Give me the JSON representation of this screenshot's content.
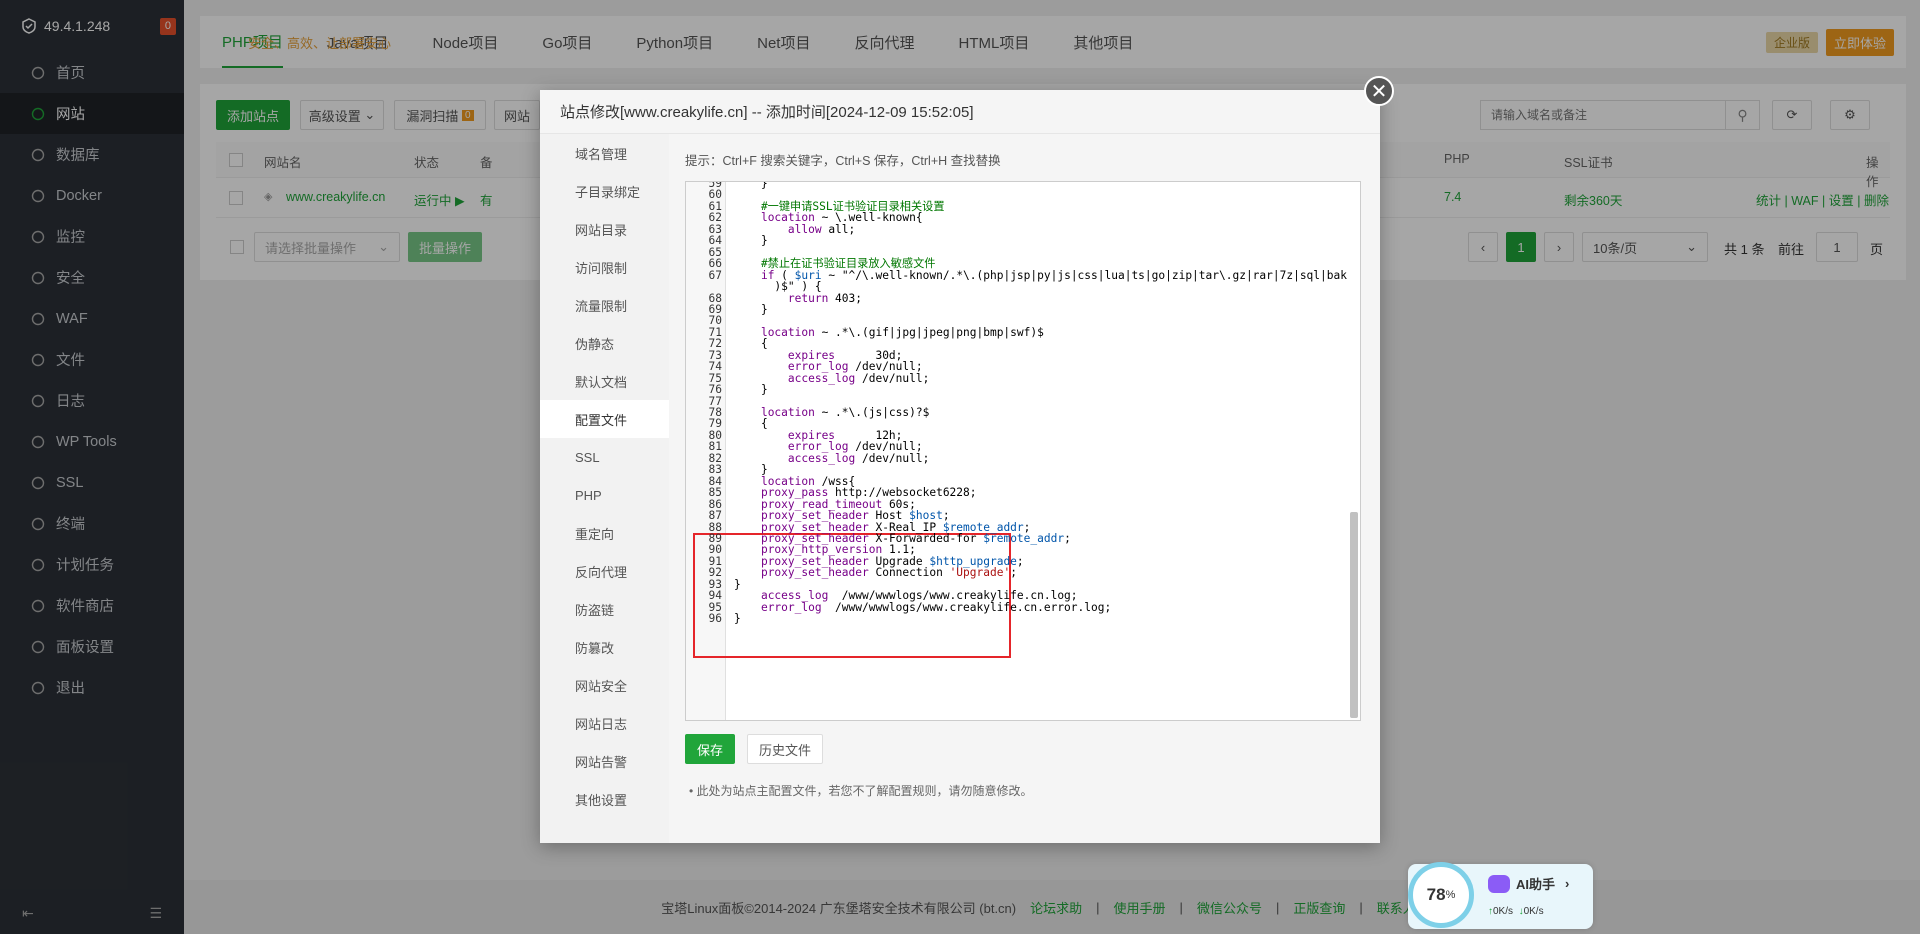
{
  "sidebar": {
    "ip": "49.4.1.248",
    "badge": "0",
    "items": [
      {
        "label": "首页",
        "icon": "home-icon"
      },
      {
        "label": "网站",
        "icon": "globe-icon"
      },
      {
        "label": "数据库",
        "icon": "database-icon"
      },
      {
        "label": "Docker",
        "icon": "docker-icon"
      },
      {
        "label": "监控",
        "icon": "monitor-icon"
      },
      {
        "label": "安全",
        "icon": "shield-icon"
      },
      {
        "label": "WAF",
        "icon": "waf-icon"
      },
      {
        "label": "文件",
        "icon": "folder-icon"
      },
      {
        "label": "日志",
        "icon": "log-icon"
      },
      {
        "label": "WP Tools",
        "icon": "wordpress-icon"
      },
      {
        "label": "SSL",
        "icon": "ssl-icon"
      },
      {
        "label": "终端",
        "icon": "terminal-icon"
      },
      {
        "label": "计划任务",
        "icon": "calendar-icon"
      },
      {
        "label": "软件商店",
        "icon": "store-icon"
      },
      {
        "label": "面板设置",
        "icon": "gear-icon"
      },
      {
        "label": "退出",
        "icon": "logout-icon"
      }
    ]
  },
  "topnav": {
    "tabs": [
      "PHP项目",
      "Java项目",
      "Node项目",
      "Go项目",
      "Python项目",
      "Net项目",
      "反向代理",
      "HTML项目",
      "其他项目"
    ],
    "promo_tag": "企业版",
    "promo_text": "安全、高效、让部署安心",
    "promo_button": "立即体验"
  },
  "toolbar": {
    "add_site": "添加站点",
    "advanced": "高级设置",
    "scan": "漏洞扫描",
    "scan_badge": "0",
    "site_short": "网站",
    "search_placeholder": "请输入域名或备注"
  },
  "table": {
    "headers": [
      "网站名",
      "状态",
      "备",
      "PHP",
      "SSL证书",
      "操作"
    ],
    "row": {
      "name": "www.creakylife.cn",
      "status": "运行中",
      "remark": "有",
      "php": "7.4",
      "ssl": "剩余360天",
      "actions": [
        "统计",
        "WAF",
        "设置",
        "删除"
      ]
    },
    "batch_placeholder": "请选择批量操作",
    "batch_button": "批量操作",
    "page": "1",
    "per_page": "10条/页",
    "total": "共 1 条",
    "goto_label": "前往",
    "goto_value": "1",
    "page_unit": "页"
  },
  "modal": {
    "title": "站点修改[www.creakylife.cn] -- 添加时间[2024-12-09 15:52:05]",
    "menu": [
      "域名管理",
      "子目录绑定",
      "网站目录",
      "访问限制",
      "流量限制",
      "伪静态",
      "默认文档",
      "配置文件",
      "SSL",
      "PHP",
      "重定向",
      "反向代理",
      "防盗链",
      "防篡改",
      "网站安全",
      "网站日志",
      "网站告警",
      "其他设置"
    ],
    "active_menu": 7,
    "hint": "提示：Ctrl+F 搜索关键字，Ctrl+S 保存，Ctrl+H 查找替换",
    "save": "保存",
    "history": "历史文件",
    "note": "此处为站点主配置文件，若您不了解配置规则，请勿随意修改。"
  },
  "code": [
    {
      "n": "59",
      "t": "    }"
    },
    {
      "n": "60",
      "t": ""
    },
    {
      "n": "61",
      "t": "    #一键申请SSL证书验证目录相关设置",
      "c": "cm"
    },
    {
      "n": "62",
      "t": "    location ~ \\.well-known{"
    },
    {
      "n": "63",
      "t": "        allow all;"
    },
    {
      "n": "64",
      "t": "    }"
    },
    {
      "n": "65",
      "t": ""
    },
    {
      "n": "66",
      "t": "    #禁止在证书验证目录放入敏感文件",
      "c": "cm"
    },
    {
      "n": "67",
      "t": "    if ( $uri ~ \"^/\\.well-known/.*\\.(php|jsp|py|js|css|lua|ts|go|zip|tar\\.gz|rar|7z|sql|bak"
    },
    {
      "n": "",
      "t": "      )$\" ) {"
    },
    {
      "n": "68",
      "t": "        return 403;"
    },
    {
      "n": "69",
      "t": "    }"
    },
    {
      "n": "70",
      "t": ""
    },
    {
      "n": "71",
      "t": "    location ~ .*\\.(gif|jpg|jpeg|png|bmp|swf)$"
    },
    {
      "n": "72",
      "t": "    {"
    },
    {
      "n": "73",
      "t": "        expires      30d;"
    },
    {
      "n": "74",
      "t": "        error_log /dev/null;"
    },
    {
      "n": "75",
      "t": "        access_log /dev/null;"
    },
    {
      "n": "76",
      "t": "    }"
    },
    {
      "n": "77",
      "t": ""
    },
    {
      "n": "78",
      "t": "    location ~ .*\\.(js|css)?$"
    },
    {
      "n": "79",
      "t": "    {"
    },
    {
      "n": "80",
      "t": "        expires      12h;"
    },
    {
      "n": "81",
      "t": "        error_log /dev/null;"
    },
    {
      "n": "82",
      "t": "        access_log /dev/null;"
    },
    {
      "n": "83",
      "t": "    }"
    },
    {
      "n": "84",
      "t": "    location /wss{"
    },
    {
      "n": "85",
      "t": "    proxy_pass http://websocket6228;"
    },
    {
      "n": "86",
      "t": "    proxy_read_timeout 60s;"
    },
    {
      "n": "87",
      "t": "    proxy_set_header Host $host;"
    },
    {
      "n": "88",
      "t": "    proxy_set_header X-Real_IP $remote_addr;"
    },
    {
      "n": "89",
      "t": "    proxy_set_header X-Forwarded-for $remote_addr;"
    },
    {
      "n": "90",
      "t": "    proxy_http_version 1.1;"
    },
    {
      "n": "91",
      "t": "    proxy_set_header Upgrade $http_upgrade;"
    },
    {
      "n": "92",
      "t": "    proxy_set_header Connection 'Upgrade';"
    },
    {
      "n": "93",
      "t": "}"
    },
    {
      "n": "94",
      "t": "    access_log  /www/wwwlogs/www.creakylife.cn.log;"
    },
    {
      "n": "95",
      "t": "    error_log  /www/wwwlogs/www.creakylife.cn.error.log;"
    },
    {
      "n": "96",
      "t": "}"
    }
  ],
  "footer": {
    "copyright": "宝塔Linux面板©2014-2024 广东堡塔安全技术有限公司 (bt.cn)",
    "links": [
      "论坛求助",
      "使用手册",
      "微信公众号",
      "正版查询",
      "联系人工"
    ]
  },
  "widget": {
    "percent": "78",
    "percent_unit": "%",
    "title": "AI助手",
    "up": "0K/s",
    "down": "0K/s"
  },
  "colors": {
    "accent": "#20a53a",
    "highlight_box": "#e5252a"
  }
}
